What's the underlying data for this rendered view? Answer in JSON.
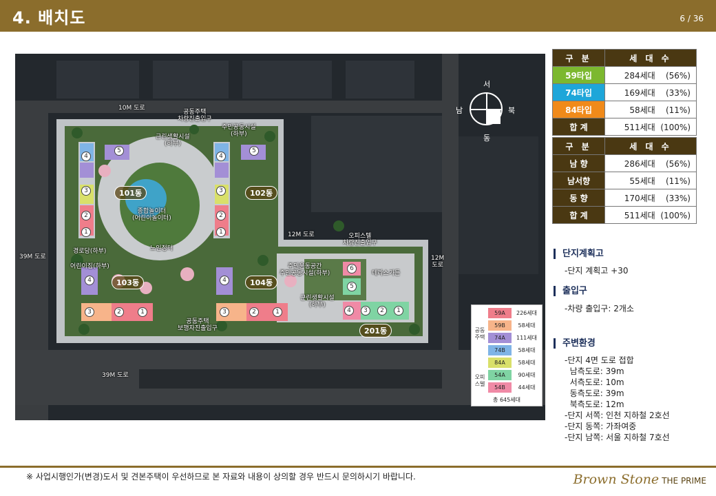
{
  "header": {
    "title": "4. 배치도",
    "page": "6 / 36"
  },
  "plan": {
    "roads": {
      "north": "10M 도로",
      "west": "39M 도로",
      "south": "39M 도로",
      "east": "12M\n도로",
      "mid": "12M 도로"
    },
    "labels": {
      "gate1": "공동주택\n차량진출입구",
      "facility1": "주민공동시설\n(하부)",
      "facility2": "근린생활시설\n(하부)",
      "playground": "종합놀이터\n(어린이놀이터)",
      "center": "노인정터",
      "senior": "경로당(하부)",
      "kids": "어린이집(하부)",
      "gate2": "오피스텔\n차량진출입구",
      "comm": "주민운동공간\n주민공동시설(하부)",
      "terrace": "테라스가든",
      "facility3": "근린생활시설\n(하부)",
      "pedestrian": "공동주택\n보행자진출입구"
    },
    "buildings": [
      "101동",
      "102동",
      "103동",
      "104동",
      "201동"
    ],
    "compass": {
      "n": "서",
      "w": "남",
      "e": "북",
      "s": "동"
    },
    "legend": {
      "group1": "공동\n주택",
      "group2": "오피\n스텔",
      "rows": [
        {
          "type": "59A",
          "count": "226세대",
          "color": "#ef7d8a"
        },
        {
          "type": "59B",
          "count": "58세대",
          "color": "#f7b48a"
        },
        {
          "type": "74A",
          "count": "111세대",
          "color": "#a38fd6"
        },
        {
          "type": "74B",
          "count": "58세대",
          "color": "#7fb4e6"
        },
        {
          "type": "84A",
          "count": "58세대",
          "color": "#d9e06a"
        },
        {
          "type": "54A",
          "count": "90세대",
          "color": "#7fd4a3"
        },
        {
          "type": "54B",
          "count": "44세대",
          "color": "#f08aa6"
        }
      ],
      "total": "총 645세대"
    }
  },
  "table1": {
    "headers": [
      "구 분",
      "세 대 수"
    ],
    "rows": [
      {
        "type": "59타입",
        "count": "284세대",
        "pct": "(56%)"
      },
      {
        "type": "74타입",
        "count": "169세대",
        "pct": "(33%)"
      },
      {
        "type": "84타입",
        "count": "58세대",
        "pct": "(11%)"
      },
      {
        "type": "합 계",
        "count": "511세대",
        "pct": "(100%)"
      }
    ]
  },
  "table2": {
    "headers": [
      "구 분",
      "세 대 수"
    ],
    "rows": [
      {
        "type": "남 향",
        "count": "286세대",
        "pct": "(56%)"
      },
      {
        "type": "남서향",
        "count": "55세대",
        "pct": "(11%)"
      },
      {
        "type": "동 향",
        "count": "170세대",
        "pct": "(33%)"
      },
      {
        "type": "합 계",
        "count": "511세대",
        "pct": "(100%)"
      }
    ]
  },
  "sections": {
    "plan_h": "단지계획고",
    "plan_b": "-단지 계획고 +30",
    "entry_h": "출입구",
    "entry_b": "-차량 출입구: 2개소",
    "env_h": "주변환경",
    "env_b": "-단지 4면 도로 접합\n  남측도로: 39m\n  서측도로: 10m\n  동측도로: 39m\n  북측도로: 12m\n-단지 서쪽: 인천 지하철 2호선\n-단지 동쪽: 가좌여중\n-단지 남쪽: 서울 지하철 7호선"
  },
  "footer": {
    "note": "※ 사업시행인가(변경)도서 및 견본주택이 우선하므로 본 자료와 내용이 상의할 경우 반드시 문의하시기 바랍니다.",
    "brand": "Brown Stone",
    "brand_sub": "THE PRIME"
  }
}
